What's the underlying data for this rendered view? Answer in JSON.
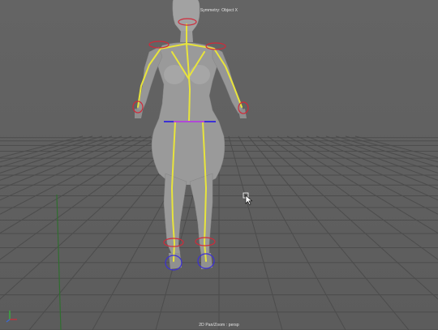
{
  "viewport": {
    "symmetry_label": "Symmetry: Object X",
    "camera_label": "2D Pan/Zoom : persp"
  },
  "icons": {
    "axis": "axis-gizmo-icon",
    "cursor": "mouse-cursor-icon"
  },
  "colors": {
    "background": "#606060",
    "grid": "#4c4c4c",
    "mesh": "#9a9a9a",
    "joints": "#e8e43c",
    "ik_handles": "#d02a3a",
    "ik_controls": "#3b2fd6",
    "grid_axis_green": "#2f6e2f"
  }
}
